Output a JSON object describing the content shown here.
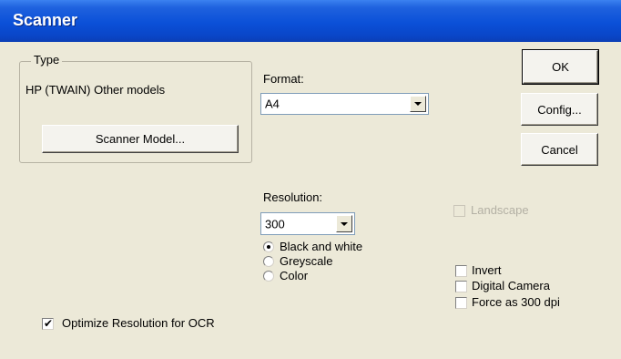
{
  "window": {
    "title": "Scanner"
  },
  "type_group": {
    "legend": "Type",
    "current_model": "HP (TWAIN) Other models",
    "scanner_model_button": "Scanner Model..."
  },
  "format": {
    "label": "Format:",
    "selected": "A4"
  },
  "resolution": {
    "label": "Resolution:",
    "selected": "300"
  },
  "color_mode": {
    "options": [
      "Black and white",
      "Greyscale",
      "Color"
    ],
    "selected": "Black and white"
  },
  "buttons": {
    "ok": "OK",
    "config": "Config...",
    "cancel": "Cancel"
  },
  "options": {
    "landscape": {
      "label": "Landscape",
      "checked": false,
      "enabled": false
    },
    "invert": {
      "label": "Invert",
      "checked": false
    },
    "digital_camera": {
      "label": "Digital Camera",
      "checked": false
    },
    "force_300": {
      "label": "Force as 300 dpi",
      "checked": false
    },
    "optimize_ocr": {
      "label": "Optimize Resolution for OCR",
      "checked": true
    }
  },
  "icons": {
    "dropdown": "chevron-down-icon",
    "check": "checkmark-icon"
  },
  "colors": {
    "title_bar": "#0b50d8",
    "dialog_bg": "#ece9d8",
    "disabled_text": "#b3b0a4"
  }
}
